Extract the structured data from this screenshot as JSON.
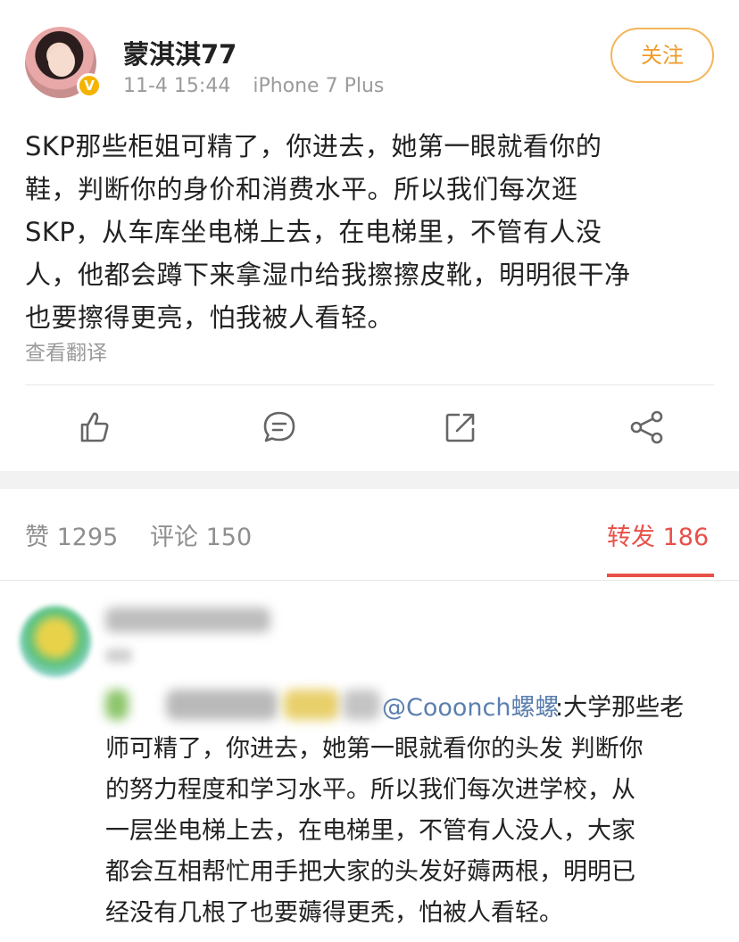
{
  "post": {
    "username": "蒙淇淇77",
    "date": "11-4 15:44",
    "device": "iPhone 7 Plus",
    "follow_label": "关注",
    "content_lines": [
      "SKP那些柜姐可精了，你进去，她第一眼就看你的",
      "鞋，判断你的身价和消费水平。所以我们每次逛",
      "SKP，从车库坐电梯上去，在电梯里，不管有人没",
      "人，他都会蹲下来拿湿巾给我擦擦皮靴，明明很干净",
      "也要擦得更亮，怕我被人看轻。"
    ],
    "translate_label": "查看翻译",
    "actions": [
      "like-icon",
      "comment-icon",
      "repost-icon",
      "share-icon"
    ]
  },
  "tabs": {
    "likes_label": "赞",
    "likes_count": "1295",
    "comments_label": "评论",
    "comments_count": "150",
    "reposts_label": "转发",
    "reposts_count": "186"
  },
  "comment": {
    "mention": "@Cooonch螺螺",
    "colon_text": ":大学那些老",
    "text_lines": [
      "师可精了，你进去，她第一眼就看你的头发 判断你",
      "的努力程度和学习水平。所以我们每次进学校，从",
      "一层坐电梯上去，在电梯里，不管有人没人，大家",
      "都会互相帮忙用手把大家的头发好薅两根，明明已",
      "经没有几根了也要薅得更秃，怕被人看轻。"
    ]
  },
  "colors": {
    "accent_red": "#e8504a",
    "follow_orange": "#f09a2b",
    "mention_blue": "#5b7fae",
    "muted_gray": "#9b9b9b"
  }
}
